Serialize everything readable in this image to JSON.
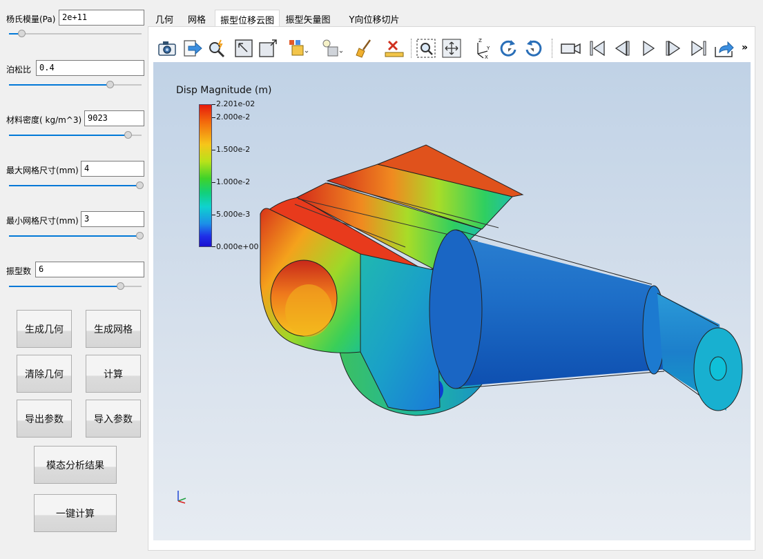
{
  "params": {
    "youngs_label": "杨氏模量(Pa)",
    "youngs_value": "2e+11",
    "youngs_slider": 0.08,
    "poisson_label": "泊松比",
    "poisson_value": "0.4",
    "poisson_slider": 0.77,
    "density_label": "材料密度( kg/m^3)",
    "density_value": "9023",
    "density_slider": 0.91,
    "max_mesh_label": "最大网格尺寸(mm)",
    "max_mesh_value": "4",
    "max_mesh_slider": 1.0,
    "min_mesh_label": "最小网格尺寸(mm)",
    "min_mesh_value": "3",
    "min_mesh_slider": 1.0,
    "modes_label": "振型数",
    "modes_value": "6",
    "modes_slider": 0.85
  },
  "buttons": {
    "gen_geometry": "生成几何",
    "gen_mesh": "生成网格",
    "clear_geometry": "清除几何",
    "compute": "计算",
    "export_params": "导出参数",
    "import_params": "导入参数",
    "modal_results": "模态分析结果",
    "one_click": "一键计算"
  },
  "tabs": [
    {
      "label": "几何",
      "active": false
    },
    {
      "label": "网格",
      "active": false
    },
    {
      "label": "振型位移云图",
      "active": true
    },
    {
      "label": "振型矢量图",
      "active": false
    },
    {
      "label": "Y向位移切片",
      "active": false
    }
  ],
  "toolbar": {
    "icons": [
      "camera-icon",
      "export-arrow-icon",
      "magic-zoom-icon",
      "reset-camera-icon",
      "resize-icon",
      "display-box-icon",
      "light-icon",
      "broom-icon",
      "ruler-icon",
      "zoom-box-icon",
      "zoom-fit-icon",
      "axes-icon",
      "rotate-cw-icon",
      "rotate-ccw-icon",
      "video-icon",
      "first-frame-icon",
      "prev-frame-icon",
      "play-icon",
      "next-frame-icon",
      "last-frame-icon",
      "share-icon"
    ],
    "overflow": "»"
  },
  "legend": {
    "title": "Disp Magnitude (m)",
    "max_label": "2.201e-02",
    "ticks": [
      "2.000e-2",
      "1.500e-2",
      "1.000e-2",
      "5.000e-3",
      "0.000e+00"
    ]
  },
  "colors": {
    "accent": "#0078d7",
    "viewport_top": "#c0d2e6",
    "viewport_bottom": "#e7ecf2"
  }
}
